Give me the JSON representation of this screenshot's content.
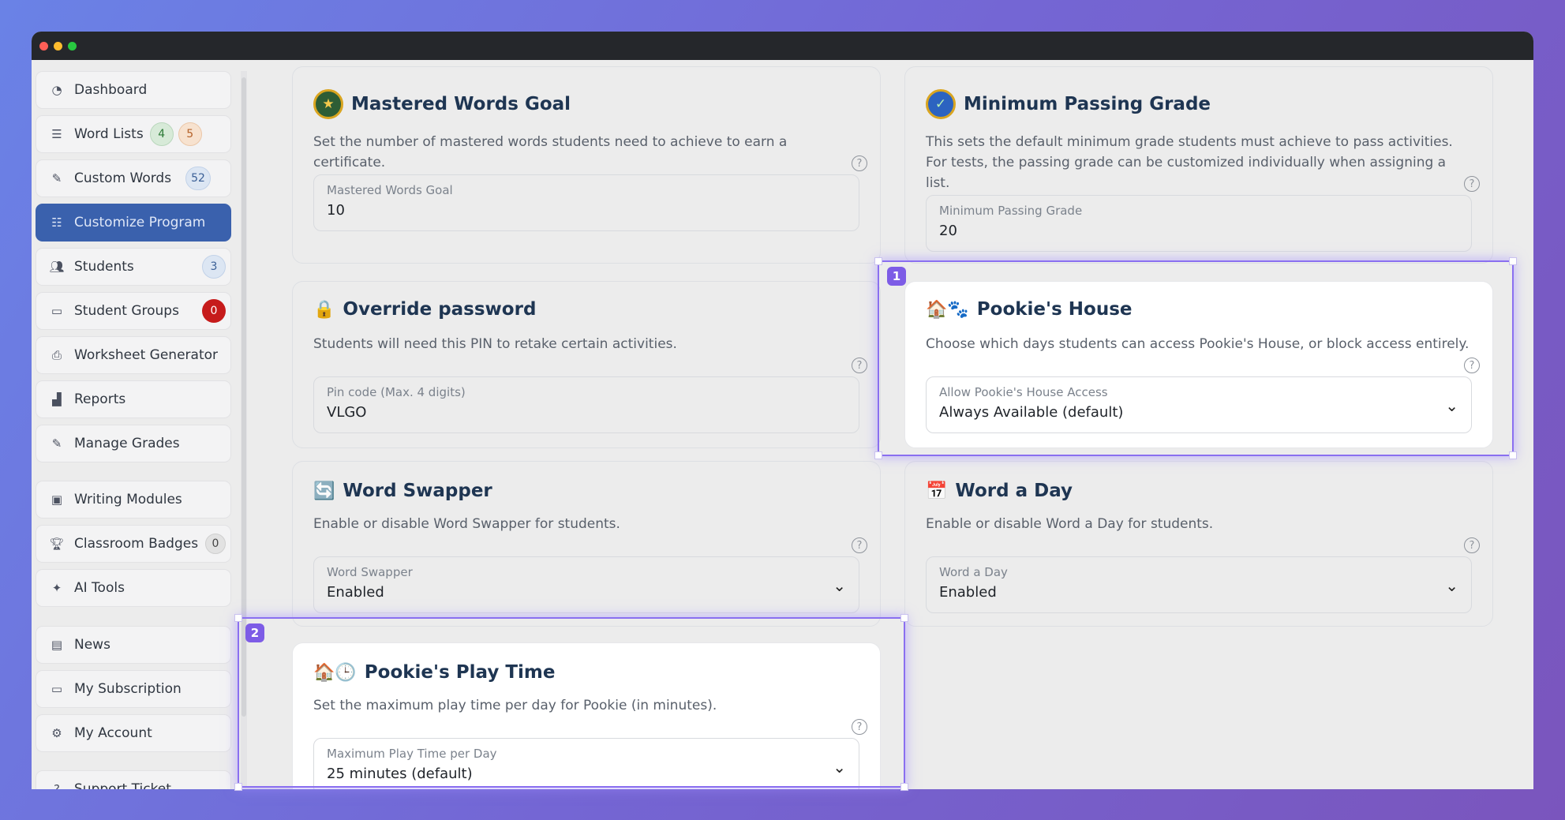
{
  "sidebar": {
    "items": [
      {
        "label": "Dashboard",
        "icon": "dashboard-icon"
      },
      {
        "label": "Word Lists",
        "icon": "list-icon",
        "badges": [
          "4",
          "5"
        ]
      },
      {
        "label": "Custom Words",
        "icon": "edit-icon",
        "badges": [
          "52"
        ]
      },
      {
        "label": "Customize Program",
        "icon": "sliders-icon",
        "active": true
      },
      {
        "label": "Students",
        "icon": "users-icon",
        "badges": [
          "3"
        ]
      },
      {
        "label": "Student Groups",
        "icon": "folder-icon",
        "badges": [
          "0"
        ]
      },
      {
        "label": "Worksheet Generator",
        "icon": "printer-icon"
      },
      {
        "label": "Reports",
        "icon": "bar-chart-icon"
      },
      {
        "label": "Manage Grades",
        "icon": "edit-icon"
      },
      {
        "label": "Writing Modules",
        "icon": "terminal-icon"
      },
      {
        "label": "Classroom Badges",
        "icon": "trophy-icon",
        "badges": [
          "0"
        ]
      },
      {
        "label": "AI Tools",
        "icon": "sparkles-icon"
      },
      {
        "label": "News",
        "icon": "newspaper-icon"
      },
      {
        "label": "My Subscription",
        "icon": "credit-card-icon"
      },
      {
        "label": "My Account",
        "icon": "gear-icon"
      },
      {
        "label": "Support Ticket",
        "icon": "help-icon"
      }
    ]
  },
  "cards": {
    "mastered": {
      "title": "Mastered Words Goal",
      "desc": "Set the number of mastered words students need to achieve to earn a certificate.",
      "field_label": "Mastered Words Goal",
      "field_value": "10"
    },
    "passing": {
      "title": "Minimum Passing Grade",
      "desc": "This sets the default minimum grade students must achieve to pass activities. For tests, the passing grade can be customized individually when assigning a list.",
      "field_label": "Minimum Passing Grade",
      "field_value": "20"
    },
    "override": {
      "emoji": "🔒",
      "title": "Override password",
      "desc": "Students will need this PIN to retake certain activities.",
      "field_label": "Pin code (Max. 4 digits)",
      "field_value": "VLGO"
    },
    "pookie_house": {
      "emoji": "🏠🐾",
      "title": "Pookie's House",
      "desc": "Choose which days students can access Pookie's House, or block access entirely.",
      "field_label": "Allow Pookie's House Access",
      "field_value": "Always Available (default)"
    },
    "word_swapper": {
      "emoji": "🔄",
      "title": "Word Swapper",
      "desc": "Enable or disable Word Swapper for students.",
      "field_label": "Word Swapper",
      "field_value": "Enabled"
    },
    "word_a_day": {
      "emoji": "📅",
      "title": "Word a Day",
      "desc": "Enable or disable Word a Day for students.",
      "field_label": "Word a Day",
      "field_value": "Enabled"
    },
    "play_time": {
      "emoji": "🏠🕒",
      "title": "Pookie's Play Time",
      "desc": "Set the maximum play time per day for Pookie (in minutes).",
      "field_label": "Maximum Play Time per Day",
      "field_value": "25 minutes (default)"
    }
  },
  "annotations": {
    "first": "1",
    "second": "2"
  },
  "help_glyph": "?",
  "chevron_glyph": "⌄"
}
